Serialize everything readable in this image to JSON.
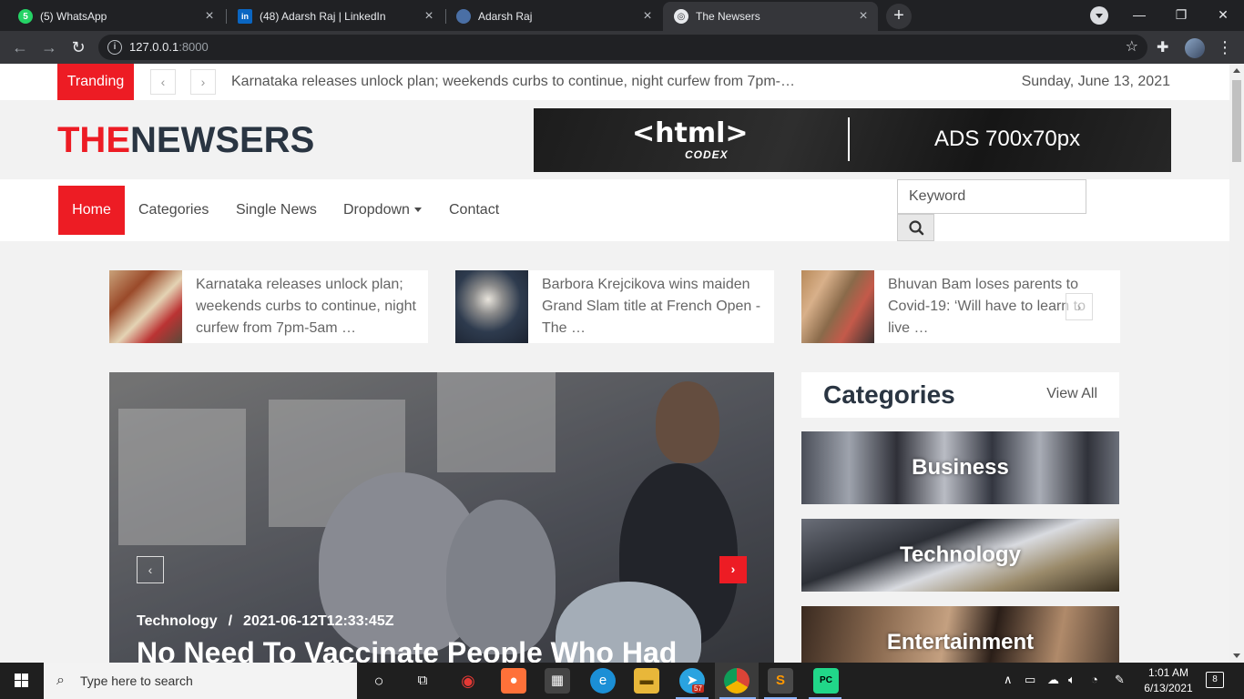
{
  "browser": {
    "tabs": [
      {
        "title": "(5) WhatsApp",
        "icon": "whatsapp-icon",
        "color": "#25d366",
        "glyph": "5"
      },
      {
        "title": "(48) Adarsh Raj | LinkedIn",
        "icon": "linkedin-icon",
        "color": "#0a66c2",
        "glyph": "in"
      },
      {
        "title": "Adarsh Raj",
        "icon": "profile-icon",
        "color": "#4a6fa5",
        "glyph": ""
      },
      {
        "title": "The Newsers",
        "icon": "globe-icon",
        "color": "#5f6368",
        "glyph": "◎"
      }
    ],
    "url_host": "127.0.0.1",
    "url_port": ":8000"
  },
  "topbar": {
    "trending_label": "Tranding",
    "trending_text": "Karnataka releases unlock plan; weekends curbs to continue, night curfew from 7pm-…",
    "date": "Sunday, June 13, 2021"
  },
  "header": {
    "logo_red": "THE",
    "logo_dark": "NEWSERS",
    "ad_brand": "<html>",
    "ad_sub": "CODEX",
    "ad_size": "ADS 700x70px"
  },
  "nav": {
    "items": [
      "Home",
      "Categories",
      "Single News",
      "Dropdown",
      "Contact"
    ],
    "search_placeholder": "Keyword"
  },
  "mini_news": [
    {
      "text": "Karnataka releases unlock plan; weekends curbs to continue, night curfew from 7pm-5am …"
    },
    {
      "text": "Barbora Krejcikova wins maiden Grand Slam title at French Open - The …"
    },
    {
      "text": "Bhuvan Bam loses parents to Covid-19: ‘Will have to learn to live …"
    }
  ],
  "hero": {
    "category": "Technology",
    "separator": "/",
    "date": "2021-06-12T12:33:45Z",
    "title": "No Need To Vaccinate People Who Had"
  },
  "categories": {
    "title": "Categories",
    "view_all": "View All",
    "items": [
      "Business",
      "Technology",
      "Entertainment"
    ]
  },
  "taskbar": {
    "search_placeholder": "Type here to search",
    "time": "1:01 AM",
    "date": "6/13/2021",
    "notifications": "8",
    "telegram_badge": "57"
  }
}
